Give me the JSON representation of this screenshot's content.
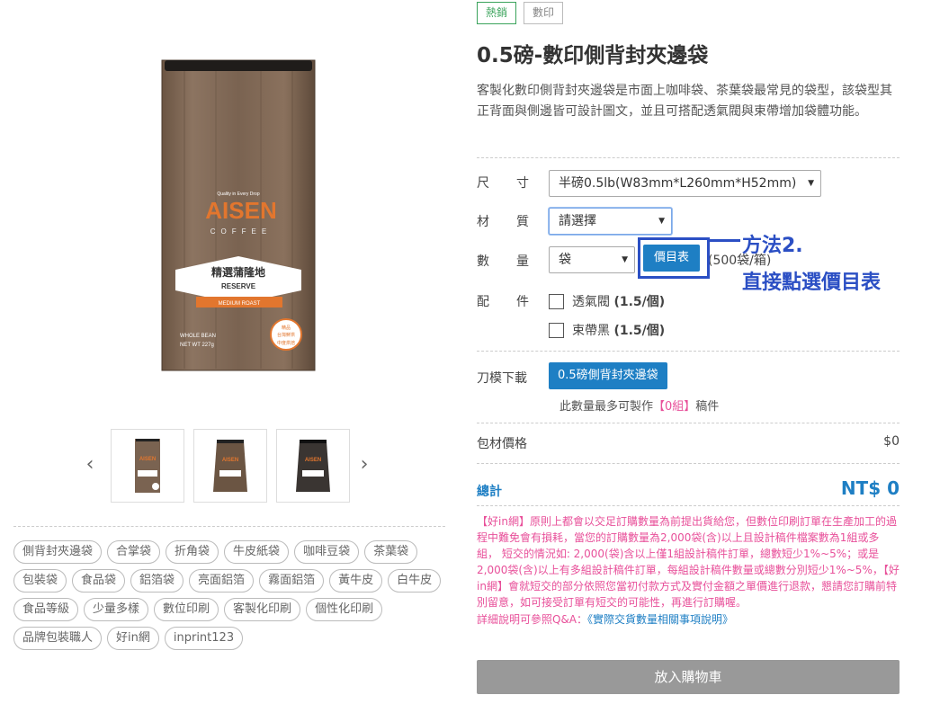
{
  "product": {
    "badges": [
      {
        "label": "熱銷"
      },
      {
        "label": "數印"
      }
    ],
    "title": "0.5磅-數印側背封夾邊袋",
    "description": "客製化數印側背封夾邊袋是市面上咖啡袋、茶葉袋最常見的袋型，該袋型其正背面與側邊皆可設計圖文，並且可搭配透氣閥與束帶增加袋體功能。"
  },
  "options": {
    "size_label_a": "尺",
    "size_label_b": "寸",
    "size_value": "半磅0.5lb(W83mm*L260mm*H52mm)",
    "material_label_a": "材",
    "material_label_b": "質",
    "material_value": "請選擇",
    "qty_label_a": "數",
    "qty_label_b": "量",
    "qty_unit": "袋",
    "price_list_btn": "價目表",
    "qty_note": "(500袋/箱)",
    "acc_label_a": "配",
    "acc_label_b": "件",
    "acc_valve": "透氣閥",
    "acc_valve_price": "(1.5/個)",
    "acc_tie": "束帶黑",
    "acc_tie_price": "(1.5/個)"
  },
  "download": {
    "label": "刀模下載",
    "button": "0.5磅側背封夾邊袋",
    "note_prefix": "此數量最多可製作",
    "note_count": "【0組】",
    "note_suffix": "稿件"
  },
  "pricing": {
    "pkg_label": "包材價格",
    "pkg_value": "$0",
    "total_label_a": "總",
    "total_label_b": "計",
    "total_value": "NT$ 0"
  },
  "notice": {
    "text": "【好in網】原則上都會以交足訂購數量為前提出貨給您，但數位印刷訂單在生產加工的過程中難免會有損耗，當您的訂購數量為2,000袋(含)以上且設計稿件檔案數為1組或多組，  短交的情況如: 2,000(袋)含以上僅1組設計稿件訂單，總數短少1%~5%；或是2,000袋(含)以上有多組設計稿件訂單，每組設計稿件數量或總數分別短少1%~5%，【好in網】會就短交的部分依照您當初付款方式及實付金額之單價進行退款，懇請您訂購前特別留意，如可接受訂單有短交的可能性，再進行訂購喔。",
    "more_prefix": "詳細說明可參照Q&A：",
    "more_link": "《實際交貨數量相關事項說明》"
  },
  "cart_button": "放入購物車",
  "annotation": {
    "line1": "方法2.",
    "line2": "直接點選價目表"
  },
  "tags": [
    "側背封夾邊袋",
    "合掌袋",
    "折角袋",
    "牛皮紙袋",
    "咖啡豆袋",
    "茶葉袋",
    "包裝袋",
    "食品袋",
    "鋁箔袋",
    "亮面鋁箔",
    "霧面鋁箔",
    "黃牛皮",
    "白牛皮",
    "食品等級",
    "少量多樣",
    "數位印刷",
    "客製化印刷",
    "個性化印刷",
    "品牌包裝職人",
    "好in網",
    "inprint123"
  ],
  "bag_art": {
    "tagline": "Quality in Every Drop",
    "brand": "AISEN",
    "sub": "COFFEE",
    "name": "精選蒲隆地",
    "reserve": "RESERVE",
    "roast": "MEDIUM ROAST",
    "bean": "WHOLE BEAN",
    "weight": "NET WT 227g",
    "seal1": "精品",
    "seal2": "台灣鮮烘",
    "seal3": "中度烘焙"
  },
  "colors": {
    "accent": "#1e7fc4",
    "notice": "#e8509a",
    "annotation": "#2b4fc4",
    "hot_badge": "#3aa35b"
  }
}
